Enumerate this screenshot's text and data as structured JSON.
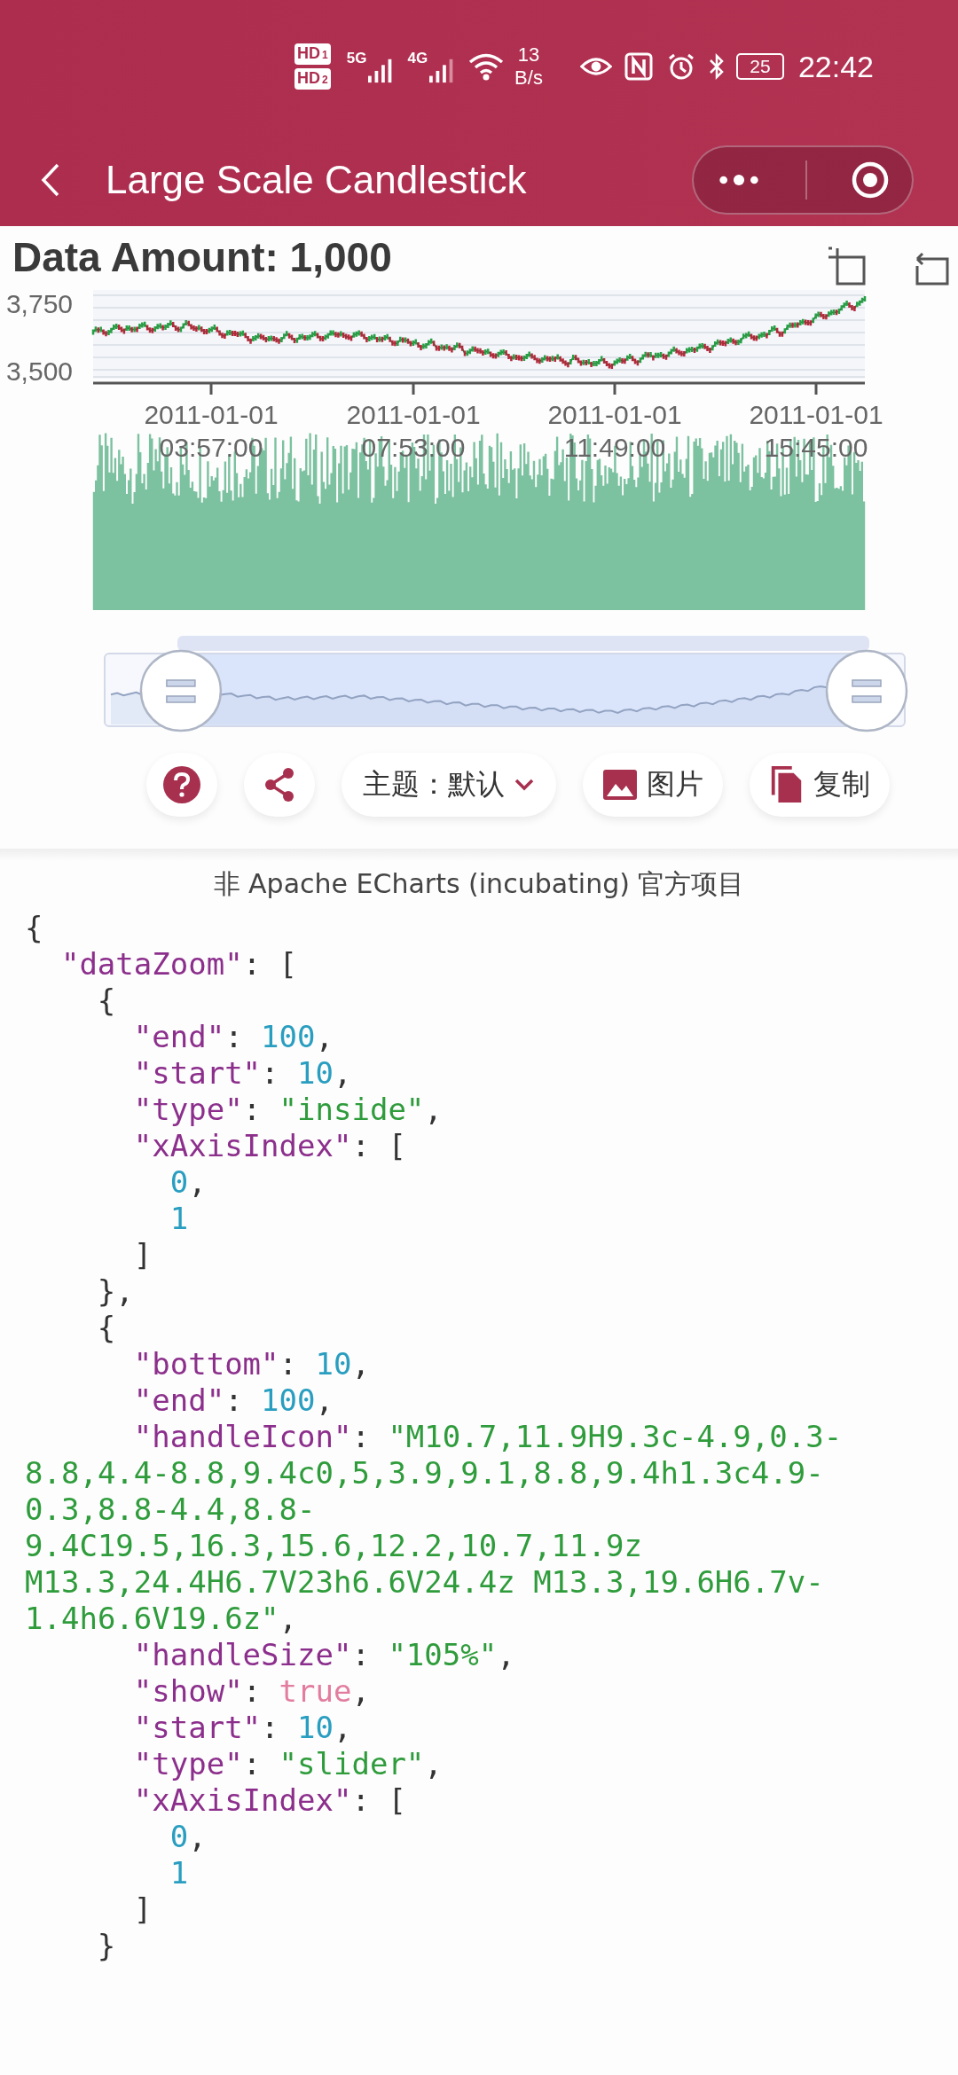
{
  "status_bar": {
    "sim_badges": [
      {
        "label": "HD",
        "index": "1"
      },
      {
        "label": "HD",
        "index": "2"
      }
    ],
    "networks": [
      "5G",
      "4G"
    ],
    "speed": {
      "value": "13",
      "unit": "B/s"
    },
    "battery": "25",
    "time": "22:42"
  },
  "nav": {
    "title": "Large Scale Candlestick"
  },
  "chart": {
    "title": "Data Amount: 1,000",
    "y_labels": [
      "3,750",
      "3,500"
    ],
    "x_labels": [
      {
        "date": "2011-01-01",
        "time": "03:57:00"
      },
      {
        "date": "2011-01-01",
        "time": "07:53:00"
      },
      {
        "date": "2011-01-01",
        "time": "11:49:00"
      },
      {
        "date": "2011-01-01",
        "time": "15:45:00"
      }
    ]
  },
  "zoom_slider": {
    "handles": [
      {
        "level": 0.1
      },
      {
        "level": 1
      }
    ]
  },
  "toolbar": [
    {
      "kind": "help"
    },
    {
      "kind": "share"
    },
    {
      "kind": "theme",
      "label": "主题：默认"
    },
    {
      "kind": "image",
      "label": "图片"
    },
    {
      "kind": "copy",
      "label": "复制"
    }
  ],
  "notice": "非 Apache ECharts (incubating) 官方项目",
  "code": [
    {
      "tokens": [
        {
          "kind": "punct",
          "text": "{"
        }
      ],
      "children": [
        {
          "tokens": [
            {
              "kind": "key",
              "text": "\"dataZoom\""
            },
            {
              "kind": "punct",
              "text": ": ["
            }
          ],
          "children": [
            {
              "tokens": [
                {
                  "kind": "punct",
                  "text": "{"
                }
              ],
              "children": [
                {
                  "tokens": [
                    {
                      "kind": "key",
                      "text": "\"end\""
                    },
                    {
                      "kind": "punct",
                      "text": ": "
                    },
                    {
                      "kind": "number",
                      "text": "100"
                    },
                    {
                      "kind": "punct",
                      "text": ","
                    }
                  ]
                },
                {
                  "tokens": [
                    {
                      "kind": "key",
                      "text": "\"start\""
                    },
                    {
                      "kind": "punct",
                      "text": ": "
                    },
                    {
                      "kind": "number",
                      "text": "10"
                    },
                    {
                      "kind": "punct",
                      "text": ","
                    }
                  ]
                },
                {
                  "tokens": [
                    {
                      "kind": "key",
                      "text": "\"type\""
                    },
                    {
                      "kind": "punct",
                      "text": ": "
                    },
                    {
                      "kind": "string",
                      "text": "\"inside\""
                    },
                    {
                      "kind": "punct",
                      "text": ","
                    }
                  ]
                },
                {
                  "tokens": [
                    {
                      "kind": "key",
                      "text": "\"xAxisIndex\""
                    },
                    {
                      "kind": "punct",
                      "text": ": ["
                    }
                  ],
                  "children": [
                    {
                      "tokens": [
                        {
                          "kind": "number",
                          "text": "0"
                        },
                        {
                          "kind": "punct",
                          "text": ","
                        }
                      ]
                    },
                    {
                      "tokens": [
                        {
                          "kind": "number",
                          "text": "1"
                        }
                      ]
                    }
                  ]
                },
                {
                  "tokens": [
                    {
                      "kind": "punct",
                      "text": "]"
                    }
                  ]
                }
              ]
            },
            {
              "tokens": [
                {
                  "kind": "punct",
                  "text": "},"
                }
              ]
            },
            {
              "tokens": [
                {
                  "kind": "punct",
                  "text": "{"
                }
              ],
              "children": [
                {
                  "tokens": [
                    {
                      "kind": "key",
                      "text": "\"bottom\""
                    },
                    {
                      "kind": "punct",
                      "text": ": "
                    },
                    {
                      "kind": "number",
                      "text": "10"
                    },
                    {
                      "kind": "punct",
                      "text": ","
                    }
                  ]
                },
                {
                  "tokens": [
                    {
                      "kind": "key",
                      "text": "\"end\""
                    },
                    {
                      "kind": "punct",
                      "text": ": "
                    },
                    {
                      "kind": "number",
                      "text": "100"
                    },
                    {
                      "kind": "punct",
                      "text": ","
                    }
                  ]
                },
                {
                  "tokens": [
                    {
                      "kind": "key",
                      "text": "\"handleIcon\""
                    },
                    {
                      "kind": "punct",
                      "text": ": "
                    },
                    {
                      "kind": "string",
                      "text": "\"M10.7,11.9H9.3c-4.9,0.3-"
                    }
                  ],
                  "wrapped": [
                    [
                      {
                        "kind": "string",
                        "text": "8.8,4.4-8.8,9.4c0,5,3.9,9.1,8.8,9.4h1.3c4.9-"
                      }
                    ],
                    [
                      {
                        "kind": "string",
                        "text": "0.3,8.8-4.4,8.8-"
                      }
                    ],
                    [
                      {
                        "kind": "string",
                        "text": "9.4C19.5,16.3,15.6,12.2,10.7,11.9z"
                      }
                    ],
                    [
                      {
                        "kind": "string",
                        "text": "M13.3,24.4H6.7V23h6.6V24.4z M13.3,19.6H6.7v-"
                      }
                    ],
                    [
                      {
                        "kind": "string",
                        "text": "1.4h6.6V19.6z\""
                      },
                      {
                        "kind": "punct",
                        "text": ","
                      }
                    ]
                  ]
                },
                {
                  "tokens": [
                    {
                      "kind": "key",
                      "text": "\"handleSize\""
                    },
                    {
                      "kind": "punct",
                      "text": ": "
                    },
                    {
                      "kind": "string",
                      "text": "\"105%\""
                    },
                    {
                      "kind": "punct",
                      "text": ","
                    }
                  ]
                },
                {
                  "tokens": [
                    {
                      "kind": "key",
                      "text": "\"show\""
                    },
                    {
                      "kind": "punct",
                      "text": ": "
                    },
                    {
                      "kind": "boolean",
                      "text": "true"
                    },
                    {
                      "kind": "punct",
                      "text": ","
                    }
                  ]
                },
                {
                  "tokens": [
                    {
                      "kind": "key",
                      "text": "\"start\""
                    },
                    {
                      "kind": "punct",
                      "text": ": "
                    },
                    {
                      "kind": "number",
                      "text": "10"
                    },
                    {
                      "kind": "punct",
                      "text": ","
                    }
                  ]
                },
                {
                  "tokens": [
                    {
                      "kind": "key",
                      "text": "\"type\""
                    },
                    {
                      "kind": "punct",
                      "text": ": "
                    },
                    {
                      "kind": "string",
                      "text": "\"slider\""
                    },
                    {
                      "kind": "punct",
                      "text": ","
                    }
                  ]
                },
                {
                  "tokens": [
                    {
                      "kind": "key",
                      "text": "\"xAxisIndex\""
                    },
                    {
                      "kind": "punct",
                      "text": ": ["
                    }
                  ],
                  "children": [
                    {
                      "tokens": [
                        {
                          "kind": "number",
                          "text": "0"
                        },
                        {
                          "kind": "punct",
                          "text": ","
                        }
                      ]
                    },
                    {
                      "tokens": [
                        {
                          "kind": "number",
                          "text": "1"
                        }
                      ]
                    }
                  ]
                },
                {
                  "tokens": [
                    {
                      "kind": "punct",
                      "text": "]"
                    }
                  ]
                }
              ]
            },
            {
              "tokens": [
                {
                  "kind": "punct",
                  "text": "}"
                }
              ]
            }
          ]
        }
      ]
    }
  ]
}
